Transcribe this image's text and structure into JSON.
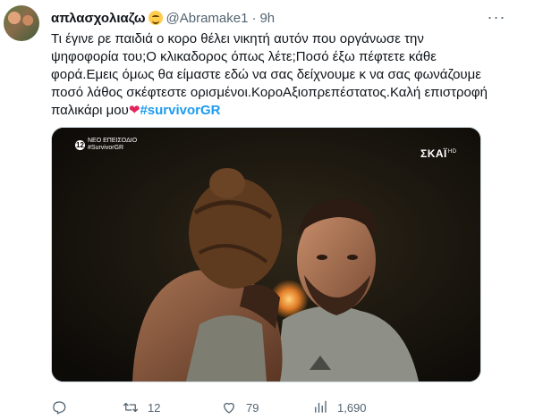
{
  "tweet": {
    "display_name": "απλασχολιαζω",
    "handle": "@Abramake1",
    "separator": "·",
    "time": "9h",
    "more_label": "···",
    "text_lines": [
      "Τι έγινε ρε παιδιά ο κορο θέλει νικητή αυτόν που οργάνωσε την",
      "ψηφοφορία του;Ο κλικαδορος όπως λέτε;Ποσό έξω πέφτετε κάθε",
      "φορά.Εμεις όμως θα είμαστε εδώ να σας δείχνουμε κ να σας φωνάζουμε",
      "ποσό λάθος σκέφτεστε ορισμένοι.ΚοροΑξιοπρεπέστατος.Καλή επιστροφή"
    ],
    "last_line_text": "παλικάρι μου",
    "heart_emoji": "❤",
    "hashtag": "#survivorGR"
  },
  "media": {
    "channel_badge": "12",
    "episode_label": "ΝΕΟ ΕΠΕΙΣΟΔΙΟ",
    "episode_hashtag": "#SurvivorGR",
    "network_logo": "ΣΚΑΪ",
    "network_hd": "HD"
  },
  "actions": {
    "reply_count": "",
    "retweet_count": "12",
    "like_count": "79",
    "view_count": "1,690"
  },
  "icons": [
    "reply-icon",
    "retweet-icon",
    "like-icon",
    "views-icon",
    "more-icon"
  ],
  "colors": {
    "accent": "#1d9bf0",
    "muted": "#536471",
    "heart": "#e0245e"
  }
}
